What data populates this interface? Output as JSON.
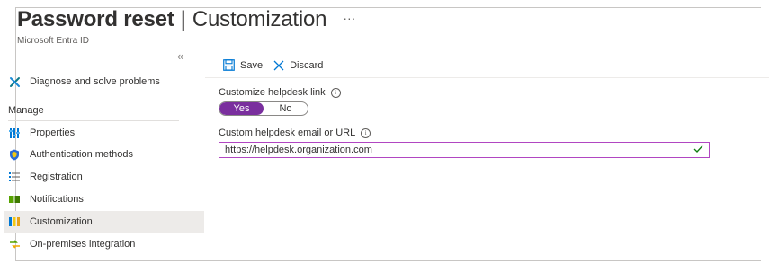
{
  "header": {
    "title": "Password reset",
    "separator": "|",
    "section": "Customization",
    "more": "···",
    "subtitle": "Microsoft Entra ID"
  },
  "sidebar": {
    "collapse": "«",
    "diagnose": {
      "label": "Diagnose and solve problems",
      "icon": "wrench-icon"
    },
    "manage_heading": "Manage",
    "items": [
      {
        "label": "Properties",
        "icon": "properties-icon"
      },
      {
        "label": "Authentication methods",
        "icon": "shield-icon"
      },
      {
        "label": "Registration",
        "icon": "list-icon"
      },
      {
        "label": "Notifications",
        "icon": "notification-icon"
      },
      {
        "label": "Customization",
        "icon": "customization-icon",
        "active": true
      },
      {
        "label": "On-premises integration",
        "icon": "sync-icon"
      }
    ]
  },
  "toolbar": {
    "save_label": "Save",
    "discard_label": "Discard"
  },
  "form": {
    "helpdesk_link_label": "Customize helpdesk link",
    "toggle_yes": "Yes",
    "toggle_no": "No",
    "toggle_selected": "Yes",
    "url_label": "Custom helpdesk email or URL",
    "url_value": "https://helpdesk.organization.com",
    "info_glyph": "i"
  },
  "colors": {
    "accent": "#7a2f9e",
    "input_border": "#b146c2",
    "active_nav_bg": "#edebe9",
    "link_blue": "#0078d4",
    "check_green": "#107c10"
  }
}
